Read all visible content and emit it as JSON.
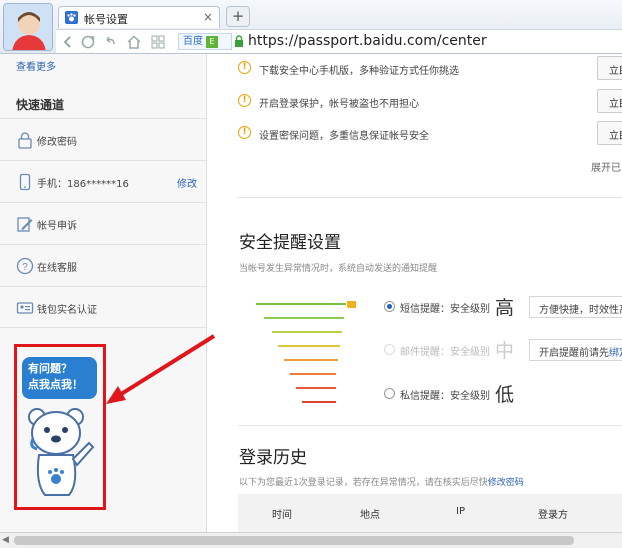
{
  "browser": {
    "tab_title": "帐号设置",
    "tab_close": "×",
    "new_tab": "+",
    "baidu_badge": "百度",
    "baidu_badge_mark": "E",
    "url": "https://passport.baidu.com/center"
  },
  "sidebar": {
    "more_link": "查看更多",
    "quick_title": "快速通道",
    "items": [
      {
        "label": "修改密码",
        "icon": "lock-icon"
      },
      {
        "label": "手机：186******16",
        "icon": "phone-icon",
        "action": "修改"
      },
      {
        "label": "帐号申诉",
        "icon": "edit-icon"
      },
      {
        "label": "在线客服",
        "icon": "question-icon"
      },
      {
        "label": "钱包实名认证",
        "icon": "id-card-icon"
      }
    ]
  },
  "help_widget": {
    "line1": "有问题？",
    "line2": "点我点我！"
  },
  "security_tips": [
    {
      "text": "下载安全中心手机版，多种验证方式任你挑选",
      "button": "立即"
    },
    {
      "text": "开启登录保护，帐号被盗也不用担心",
      "button": "立即"
    },
    {
      "text": "设置密保问题，多重信息保证帐号安全",
      "button": "立即"
    }
  ],
  "expand_link": "展开已",
  "alert_settings": {
    "title": "安全提醒设置",
    "subtitle": "当帐号发生异常情况时，系统自动发送的通知提醒",
    "options": [
      {
        "label": "短信提醒：安全级别",
        "level": "高",
        "tip": "方便快捷，时效性高",
        "selected": true
      },
      {
        "label": "邮件提醒：安全级别",
        "level": "中",
        "tip_prefix": "开启提醒前请先",
        "tip_link": "绑定",
        "selected": false
      },
      {
        "label": "私信提醒：安全级别",
        "level": "低",
        "selected": false
      }
    ]
  },
  "login_history": {
    "title": "登录历史",
    "subtitle_prefix": "以下为您最近1次登录记录，若存在异常情况，请在核实后尽快",
    "subtitle_link": "修改密码",
    "columns": [
      "时间",
      "地点",
      "IP",
      "登录方"
    ]
  },
  "colors": {
    "accent": "#2d64b3",
    "highlight_red": "#e0161b",
    "warning": "#e8a000"
  }
}
